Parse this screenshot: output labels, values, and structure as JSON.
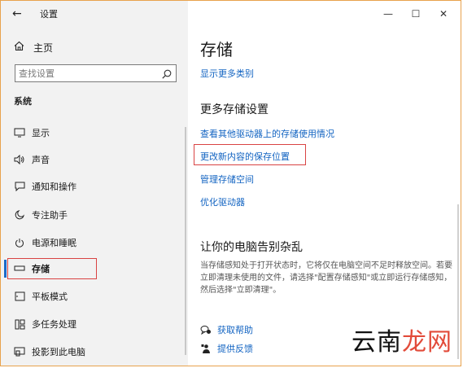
{
  "window": {
    "title": "设置",
    "back_glyph": "←",
    "controls": {
      "minimize": "—",
      "maximize": "☐",
      "close": "✕"
    }
  },
  "sidebar": {
    "home_label": "主页",
    "search_placeholder": "查找设置",
    "section_title": "系统",
    "items": [
      {
        "label": "显示",
        "icon": "monitor-icon"
      },
      {
        "label": "声音",
        "icon": "speaker-icon"
      },
      {
        "label": "通知和操作",
        "icon": "notification-icon"
      },
      {
        "label": "专注助手",
        "icon": "moon-icon"
      },
      {
        "label": "电源和睡眠",
        "icon": "power-icon"
      },
      {
        "label": "存储",
        "icon": "storage-icon",
        "selected": true
      },
      {
        "label": "平板模式",
        "icon": "tablet-icon"
      },
      {
        "label": "多任务处理",
        "icon": "multitask-icon"
      },
      {
        "label": "投影到此电脑",
        "icon": "project-icon"
      }
    ]
  },
  "main": {
    "title": "存储",
    "show_more_categories": "显示更多类别",
    "more_settings_heading": "更多存储设置",
    "links": [
      "查看其他驱动器上的存储使用情况",
      "更改新内容的保存位置",
      "管理存储空间",
      "优化驱动器"
    ],
    "declutter_heading": "让你的电脑告别杂乱",
    "declutter_desc": "当存储感知处于打开状态时，它将仅在电脑空间不足时释放空间。若要立即清理未使用的文件，请选择\"配置存储感知\"或立即运行存储感知，然后选择\"立即清理\"。",
    "help": {
      "get_help": "获取帮助",
      "feedback": "提供反馈"
    }
  },
  "watermark": {
    "part1": "云南",
    "part2": "龙网"
  },
  "colors": {
    "accent": "#1364c2",
    "highlight_box": "#d94343",
    "frame_border": "#e8a24c"
  }
}
